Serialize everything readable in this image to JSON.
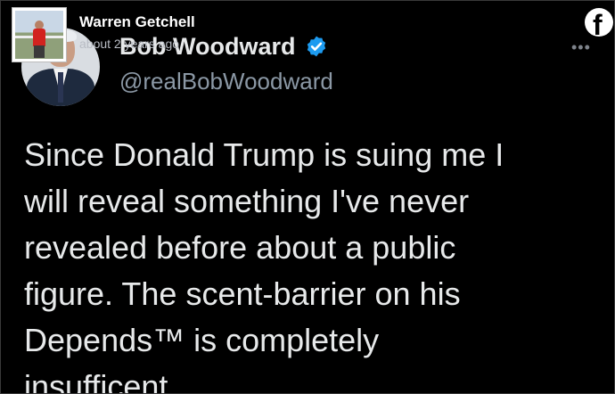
{
  "post": {
    "author": "Warren Getchell",
    "timestamp": "about 2 years ago",
    "more_label": "•••",
    "brand_glyph": "f"
  },
  "tweet": {
    "name": "Bob Woodward",
    "handle": "@realBobWoodward",
    "text": "Since Donald Trump is suing me I\nwill reveal something I've never\nrevealed before about a public\nfigure. The scent-barrier on his\nDepends™ is completely\ninsufficent."
  },
  "colors": {
    "background": "#000000",
    "verified_badge": "#1d9bf0",
    "handle": "#8b98a5"
  },
  "icons": {
    "verified": "verified-badge-icon",
    "facebook": "facebook-logo-icon",
    "more": "more-options-icon"
  }
}
